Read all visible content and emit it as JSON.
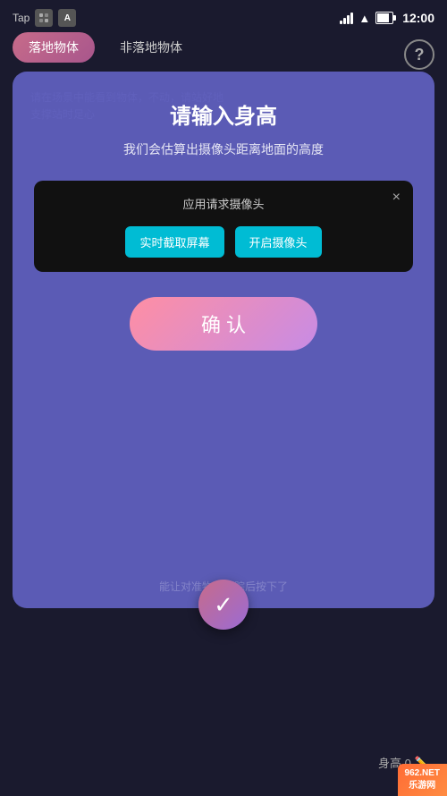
{
  "status_bar": {
    "app_label": "Tap",
    "time": "12:00"
  },
  "tabs": {
    "active": "落地物体",
    "inactive": "非落地物体"
  },
  "help": {
    "label": "?"
  },
  "modal": {
    "title": "请输入身高",
    "subtitle": "我们会估算出摄像头距离地面的高度"
  },
  "camera_dialog": {
    "title": "应用请求摄像头",
    "close_label": "×",
    "btn1": "实时截取屏幕",
    "btn2": "开启摄像头"
  },
  "confirm_btn": {
    "label": "确 认"
  },
  "bg_hint_line1": "请在场景中能看到物体，不动，请站好地",
  "bg_hint_line2": "支撑站时足心",
  "bg_hint_line3": "能让对准物体追踪后按下了",
  "bottom": {
    "height_label": "身高 0"
  },
  "watermark": "962.NET\n乐游网"
}
